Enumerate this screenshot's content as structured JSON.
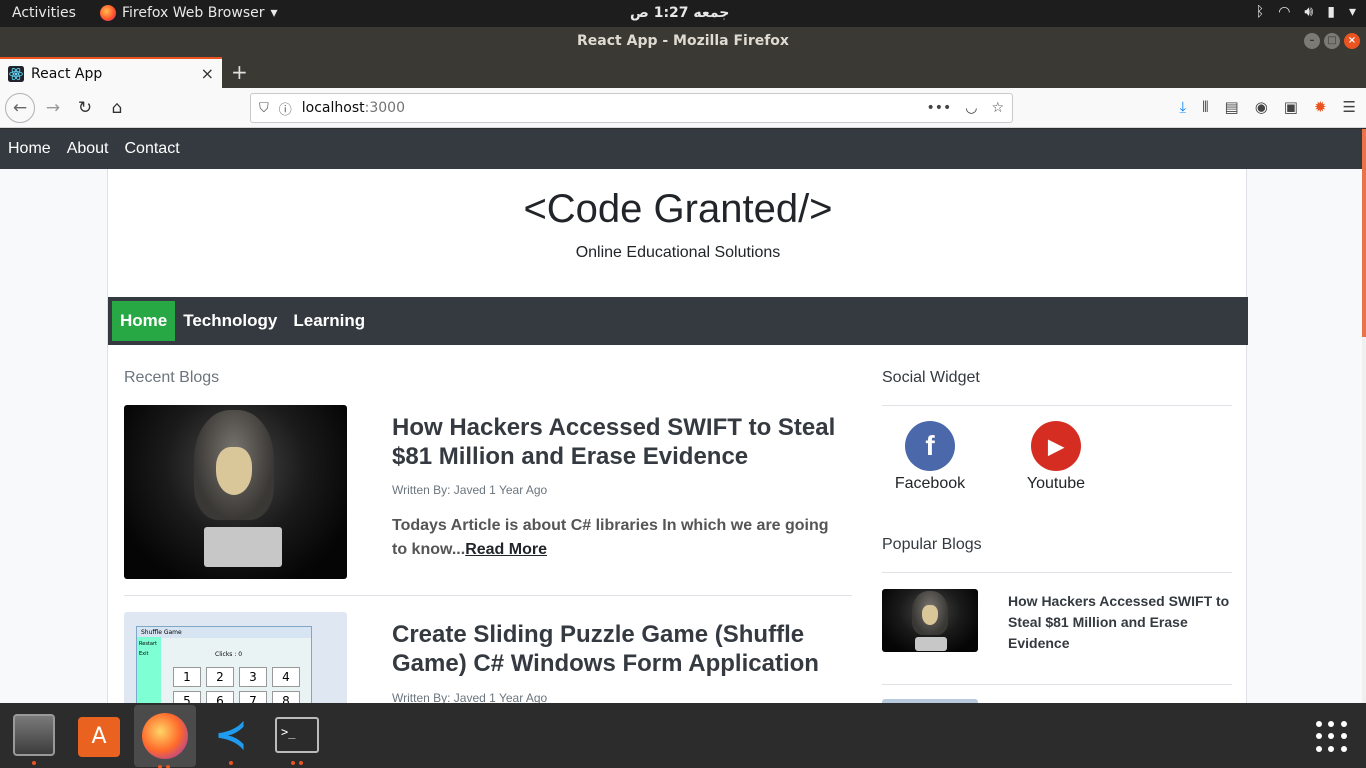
{
  "system": {
    "activities": "Activities",
    "app_menu": "Firefox Web Browser",
    "clock": "جمعه  1:27 ص"
  },
  "window": {
    "title": "React App - Mozilla Firefox"
  },
  "tab": {
    "label": "React App",
    "close": "×",
    "new_tab": "+"
  },
  "urlbar": {
    "host": "localhost",
    "port": ":3000"
  },
  "site_nav": {
    "items": [
      "Home",
      "About",
      "Contact"
    ]
  },
  "header": {
    "brand": "<Code Granted/>",
    "tagline": "Online Educational Solutions"
  },
  "category_nav": {
    "items": [
      "Home",
      "Technology",
      "Learning"
    ],
    "active": "Home"
  },
  "main": {
    "section_title": "Recent Blogs",
    "posts": [
      {
        "title": "How Hackers Accessed SWIFT to Steal $81 Million and Erase Evidence",
        "meta": "Written By: Javed 1 Year Ago",
        "excerpt": "Todays Article is about C# libraries In which we are going to know...",
        "read_more": "Read More"
      },
      {
        "title": "Create Sliding Puzzle Game (Shuffle Game) C# Windows Form Application",
        "meta": "Written By: Javed 1 Year Ago"
      }
    ]
  },
  "sidebar": {
    "social_title": "Social Widget",
    "social": [
      {
        "label": "Facebook",
        "glyph": "f",
        "color": "#3b5998"
      },
      {
        "label": "Youtube",
        "glyph": "▶",
        "color": "#e52d27"
      }
    ],
    "popular_title": "Popular Blogs",
    "popular": [
      {
        "title": "How Hackers Accessed SWIFT to Steal $81 Million and Erase Evidence"
      }
    ]
  },
  "puzzle": {
    "window_title": "Shuffle Game",
    "clicks": "Clicks :  0",
    "side_restart": "Restart",
    "side_exit": "Exit",
    "tiles": [
      "1",
      "2",
      "3",
      "4",
      "5",
      "6",
      "7",
      "8"
    ]
  },
  "colors": {
    "accent": "#e95420",
    "nav_dark": "#343a40",
    "active_green": "#28a745"
  }
}
